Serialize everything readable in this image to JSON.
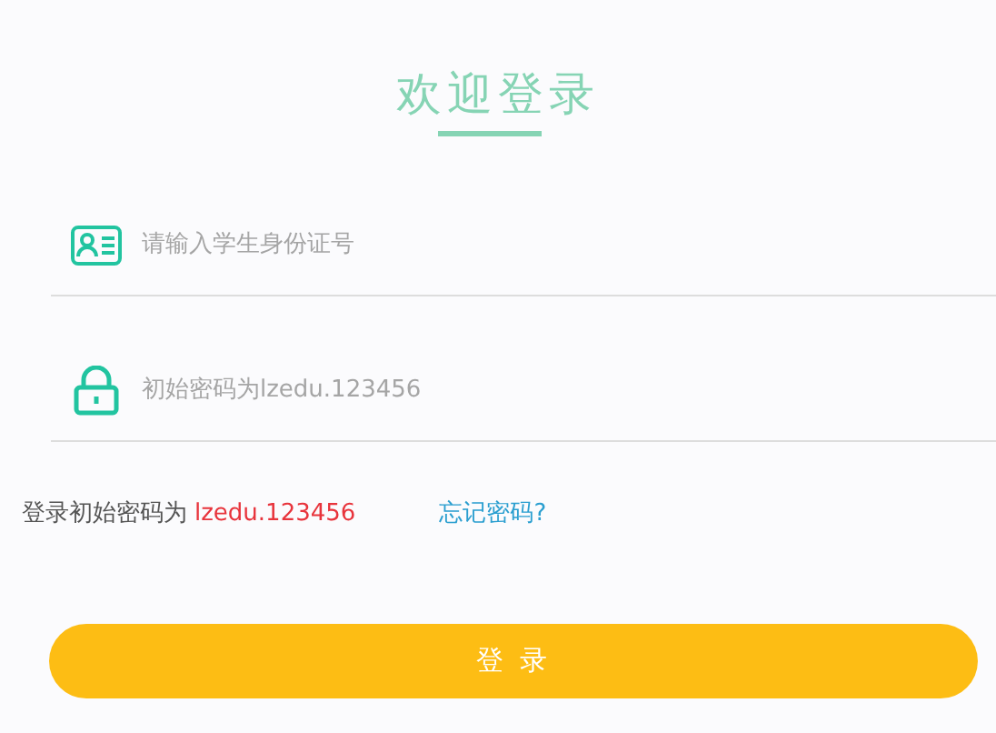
{
  "title": "欢迎登录",
  "fields": [
    {
      "kind": "id",
      "placeholder": "请输入学生身份证号"
    },
    {
      "kind": "password",
      "placeholder": "初始密码为lzedu.123456"
    }
  ],
  "hint": {
    "label": "登录初始密码为",
    "password": "lzedu.123456"
  },
  "forgot_link": "忘记密码?",
  "login_button": "登 录"
}
